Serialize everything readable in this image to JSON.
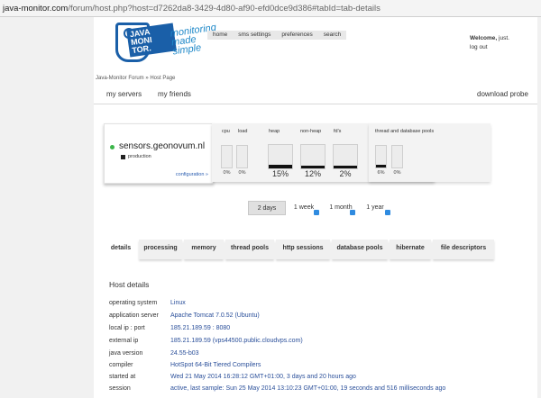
{
  "browser": {
    "domain": "java-monitor.com",
    "path": "/forum/host.php?host=d7262da8-3429-4d80-af90-efd0dce9d386#tabId=tab-details"
  },
  "logo": {
    "text": "JAVA MONI TOR.",
    "tagline": "monitoring made simple"
  },
  "topnav": {
    "items": [
      "home",
      "sms settings",
      "preferences",
      "search"
    ]
  },
  "user": {
    "welcome_label": "Welcome,",
    "name": "just.",
    "logout": "log out"
  },
  "breadcrumb": "Java-Monitor Forum » Host Page",
  "subnav": {
    "my_servers": "my servers",
    "my_friends": "my friends",
    "download_probe": "download probe"
  },
  "host": {
    "name": "sensors.geonovum.nl",
    "environment": "production",
    "configuration_link": "configuration »",
    "status_color": "#3cb54a"
  },
  "metrics": {
    "cpu": {
      "label": "cpu",
      "value": "0%",
      "fraction": 0.0
    },
    "load": {
      "label": "load",
      "value": "0%",
      "fraction": 0.0
    },
    "heap": {
      "label": "heap",
      "value": "15%",
      "fraction": 0.15
    },
    "non_heap": {
      "label": "non-heap",
      "value": "12%",
      "fraction": 0.12
    },
    "fds": {
      "label": "fd's",
      "value": "2%",
      "fraction": 0.02
    },
    "pools_label": "thread and database pools",
    "pool1": {
      "value": "6%",
      "fraction": 0.06
    },
    "pool2": {
      "value": "0%",
      "fraction": 0.0
    }
  },
  "ranges": {
    "two_days": "2 days",
    "one_week": "1 week",
    "one_month": "1 month",
    "one_year": "1 year"
  },
  "tabs": [
    "details",
    "processing",
    "memory",
    "thread pools",
    "http sessions",
    "database pools",
    "hibernate",
    "file descriptors"
  ],
  "details": {
    "title": "Host details",
    "rows": [
      {
        "key": "operating system",
        "value": "Linux"
      },
      {
        "key": "application server",
        "value": "Apache Tomcat 7.0.52 (Ubuntu)"
      },
      {
        "key": "local ip : port",
        "value": "185.21.189.59 : 8080"
      },
      {
        "key": "external ip",
        "value": "185.21.189.59 (vps44500.public.cloudvps.com)"
      },
      {
        "key": "java version",
        "value": "24.55-b03"
      },
      {
        "key": "compiler",
        "value": "HotSpot 64-Bit Tiered Compilers"
      },
      {
        "key": "started at",
        "value": "Wed 21 May 2014 16:28:12 GMT+01:00, 3 days and 20 hours ago"
      },
      {
        "key": "session",
        "value": "active, last sample: Sun 25 May 2014 13:10:23 GMT+01:00, 19 seconds and 516 milliseconds ago"
      }
    ]
  }
}
